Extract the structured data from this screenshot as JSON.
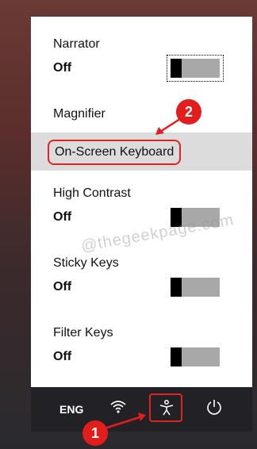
{
  "panel": {
    "narrator": {
      "label": "Narrator",
      "state": "Off"
    },
    "magnifier": {
      "label": "Magnifier"
    },
    "on_screen_keyboard": {
      "label": "On-Screen Keyboard"
    },
    "high_contrast": {
      "label": "High Contrast",
      "state": "Off"
    },
    "sticky_keys": {
      "label": "Sticky Keys",
      "state": "Off"
    },
    "filter_keys": {
      "label": "Filter Keys",
      "state": "Off"
    }
  },
  "watermark": "@thegeekpage.com",
  "taskbar": {
    "language": "ENG",
    "icons": [
      "wifi-icon",
      "accessibility-icon",
      "power-icon"
    ]
  },
  "annotations": {
    "step1": "1",
    "step2": "2",
    "color": "#e31c1c"
  }
}
